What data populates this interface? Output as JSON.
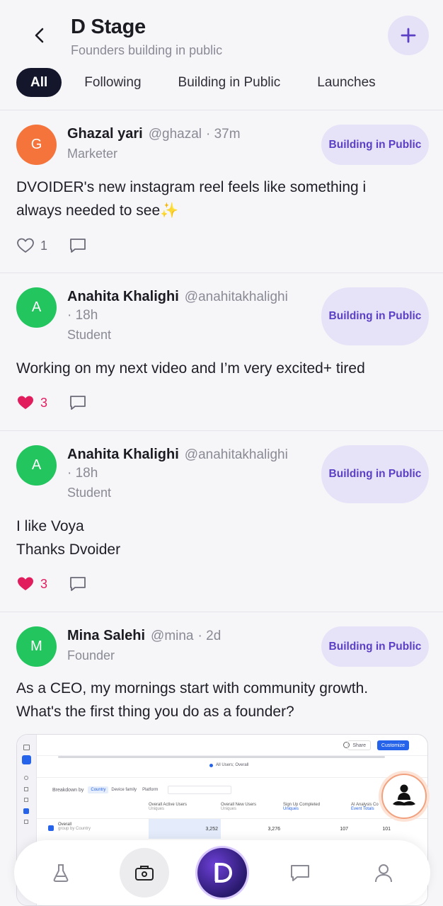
{
  "header": {
    "title": "D Stage",
    "subtitle": "Founders building in public"
  },
  "tabs": [
    {
      "label": "All",
      "active": true
    },
    {
      "label": "Following",
      "active": false
    },
    {
      "label": "Building in Public",
      "active": false
    },
    {
      "label": "Launches",
      "active": false
    }
  ],
  "posts": [
    {
      "avatar_letter": "G",
      "avatar_color": "#f4743b",
      "name": "Ghazal yari",
      "handle": "@ghazal",
      "time": "· 37m",
      "role": "Marketer",
      "tag": "Building in Public",
      "text": "DVOIDER's new instagram reel feels like something i always needed to see✨",
      "likes": "1",
      "liked": false
    },
    {
      "avatar_letter": "A",
      "avatar_color": "#22c55e",
      "name": "Anahita Khalighi",
      "handle": "@anahitakhalighi",
      "time": "· 18h",
      "role": "Student",
      "tag": "Building in Public",
      "text": "Working on my next video and I’m very excited+ tired",
      "likes": "3",
      "liked": true
    },
    {
      "avatar_letter": "A",
      "avatar_color": "#22c55e",
      "name": "Anahita Khalighi",
      "handle": "@anahitakhalighi",
      "time": "· 18h",
      "role": "Student",
      "tag": "Building in Public",
      "text_line1": "I like Voya",
      "text_line2": "Thanks Dvoider",
      "likes": "3",
      "liked": true
    },
    {
      "avatar_letter": "M",
      "avatar_color": "#22c55e",
      "name": "Mina Salehi",
      "handle": "@mina",
      "time": "· 2d",
      "role": "Founder",
      "tag": "Building in Public",
      "text": "As a CEO, my mornings start with community growth. What's the first thing you do as a founder?"
    }
  ],
  "embedded_screenshot": {
    "share": "Share",
    "customize": "Customize",
    "legend": "All Users; Overall",
    "breakdown": "Breakdown by",
    "filters": [
      "Country",
      "Device family",
      "Platform"
    ],
    "columns": [
      "Overall Active Users",
      "Overall New Users",
      "Sign Up Completed",
      "AI Analysis Co"
    ],
    "subcols": [
      "Uniques",
      "Uniques",
      "Uniques",
      "Event Totals"
    ],
    "row_label": "Overall",
    "row_sub": "group by Country",
    "row_values": [
      "3,252",
      "3,276",
      "107",
      "101"
    ]
  },
  "icons": {
    "back": "chevron-left-icon",
    "add": "plus-icon",
    "like": "heart-icon",
    "comment": "comment-icon",
    "bot": "meditating-bot-icon",
    "nav": [
      "flask-icon",
      "camera-briefcase-icon",
      "dvoider-logo-icon",
      "chat-icon",
      "profile-icon"
    ]
  },
  "colors": {
    "accent": "#5b3fc4",
    "pill_bg": "#e6e3f8",
    "like": "#e21d5d",
    "tab_active": "#14162b"
  }
}
